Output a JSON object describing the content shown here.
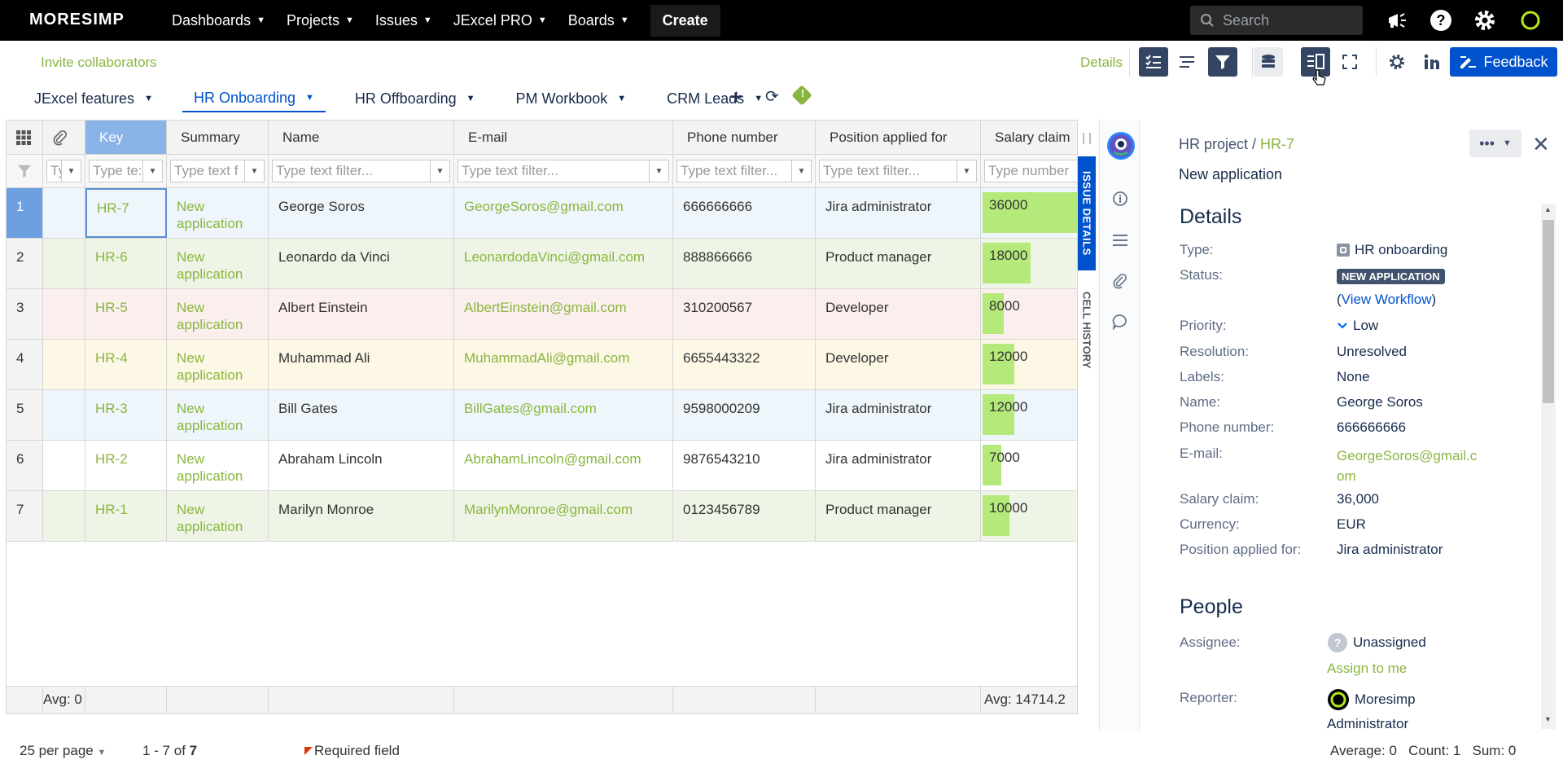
{
  "topnav": {
    "logo": "MORESIMP",
    "items": [
      {
        "label": "Dashboards"
      },
      {
        "label": "Projects"
      },
      {
        "label": "Issues"
      },
      {
        "label": "JExcel PRO"
      },
      {
        "label": "Boards"
      }
    ],
    "create": "Create",
    "search_placeholder": "Search"
  },
  "toolbar": {
    "invite": "Invite collaborators",
    "details": "Details",
    "feedback": "Feedback"
  },
  "tabs": [
    {
      "label": "JExcel features"
    },
    {
      "label": "HR Onboarding"
    },
    {
      "label": "HR Offboarding"
    },
    {
      "label": "PM Workbook"
    },
    {
      "label": "CRM Leads"
    }
  ],
  "grid": {
    "columns": [
      "Key",
      "Summary",
      "Name",
      "E-mail",
      "Phone number",
      "Position applied for",
      "Salary claim"
    ],
    "filters": [
      "Typ",
      "Type te:",
      "Type text f",
      "Type text filter...",
      "Type text filter...",
      "Type text filter...",
      "Type text filter...",
      "Type number"
    ],
    "rows": [
      {
        "n": "1",
        "key": "HR-7",
        "summary": "New application",
        "name": "George Soros",
        "email": "GeorgeSoros@gmail.com",
        "phone": "666666666",
        "position": "Jira administrator",
        "salary": "36000",
        "salary_value": 36000,
        "color": "#eef6fb"
      },
      {
        "n": "2",
        "key": "HR-6",
        "summary": "New application",
        "name": "Leonardo da Vinci",
        "email": "LeonardodaVinci@gmail.com",
        "phone": "888866666",
        "position": "Product manager",
        "salary": "18000",
        "salary_value": 18000,
        "color": "#eef5e6"
      },
      {
        "n": "3",
        "key": "HR-5",
        "summary": "New application",
        "name": "Albert Einstein",
        "email": "AlbertEinstein@gmail.com",
        "phone": "310200567",
        "position": "Developer",
        "salary": "8000",
        "salary_value": 8000,
        "color": "#fbefed"
      },
      {
        "n": "4",
        "key": "HR-4",
        "summary": "New application",
        "name": "Muhammad Ali",
        "email": "MuhammadAli@gmail.com",
        "phone": "6655443322",
        "position": "Developer",
        "salary": "12000",
        "salary_value": 12000,
        "color": "#fdf7e6"
      },
      {
        "n": "5",
        "key": "HR-3",
        "summary": "New application",
        "name": "Bill Gates",
        "email": "BillGates@gmail.com",
        "phone": "9598000209",
        "position": "Jira administrator",
        "salary": "12000",
        "salary_value": 12000,
        "color": "#eef6fb"
      },
      {
        "n": "6",
        "key": "HR-2",
        "summary": "New application",
        "name": "Abraham Lincoln",
        "email": "AbrahamLincoln@gmail.com",
        "phone": "9876543210",
        "position": "Jira administrator",
        "salary": "7000",
        "salary_value": 7000,
        "color": "#ffffff"
      },
      {
        "n": "7",
        "key": "HR-1",
        "summary": "New application",
        "name": "Marilyn Monroe",
        "email": "MarilynMonroe@gmail.com",
        "phone": "0123456789",
        "position": "Product manager",
        "salary": "10000",
        "salary_value": 10000,
        "color": "#eef5e6"
      }
    ],
    "footer_avg_left": "Avg: 0",
    "footer_avg_right": "Avg: 14714.2",
    "per_page": "25 per page",
    "range": "1 - 7 of ",
    "total": "7",
    "required": "Required field",
    "stats": "Average: 0   Count: 1   Sum: 0"
  },
  "side_tabs": {
    "issue_details": "ISSUE DETAILS",
    "cell_history": "CELL HISTORY"
  },
  "panel": {
    "project": "HR project / ",
    "key": "HR-7",
    "title": "New application",
    "details_title": "Details",
    "fields": {
      "type_label": "Type:",
      "type_value": "HR onboarding",
      "status_label": "Status:",
      "status_value": "NEW APPLICATION",
      "workflow": "View Workflow",
      "priority_label": "Priority:",
      "priority_value": "Low",
      "resolution_label": "Resolution:",
      "resolution_value": "Unresolved",
      "labels_label": "Labels:",
      "labels_value": "None",
      "name_label": "Name:",
      "name_value": "George Soros",
      "phone_label": "Phone number:",
      "phone_value": "666666666",
      "email_label": "E-mail:",
      "email_value1": "GeorgeSoros@gmail.c",
      "email_value2": "om",
      "salary_label": "Salary claim:",
      "salary_value": "36,000",
      "currency_label": "Currency:",
      "currency_value": "EUR",
      "position_label": "Position applied for:",
      "position_value": "Jira administrator"
    },
    "people_title": "People",
    "assignee_label": "Assignee:",
    "assignee_value": "Unassigned",
    "assign_to_me": "Assign to me",
    "reporter_label": "Reporter:",
    "reporter_value1": "Moresimp",
    "reporter_value2": "Administrator"
  },
  "colors": {
    "accent": "#0052cc",
    "green": "#8ab53f",
    "salary_bar": "#b5ea7a"
  }
}
